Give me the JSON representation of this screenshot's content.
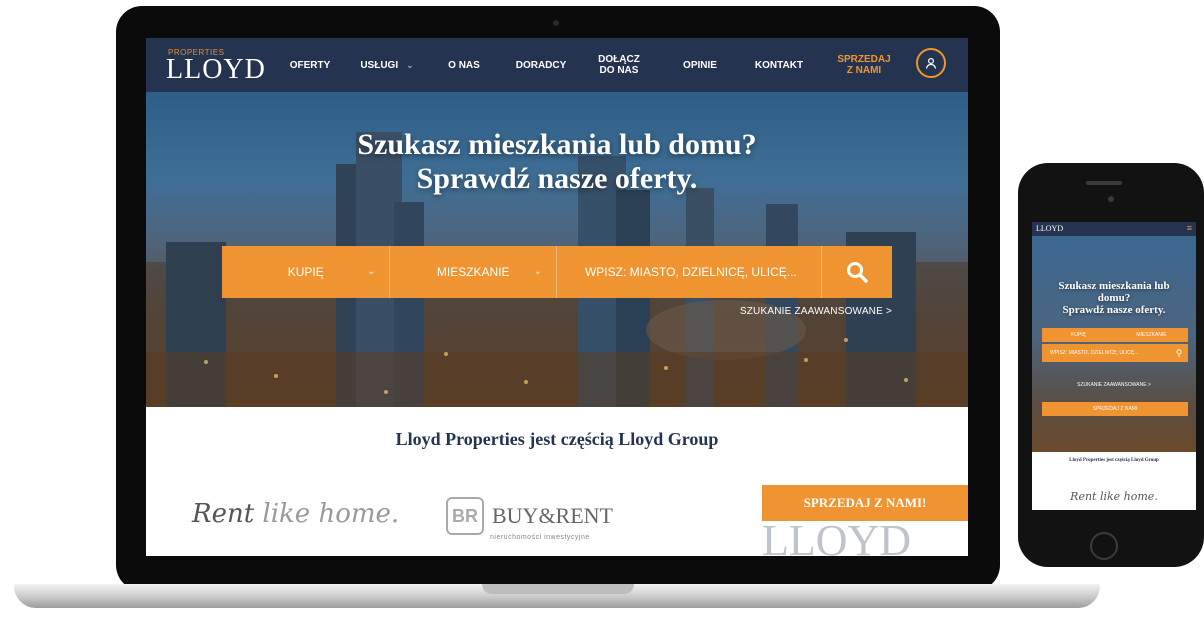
{
  "laptop": {
    "nav": {
      "logo_small": "PROPERTIES",
      "logo": "LLOYD",
      "items": [
        {
          "label": "OFERTY"
        },
        {
          "label": "USŁUGI",
          "chevron": "chevron-down-icon"
        },
        {
          "label": "O NAS"
        },
        {
          "label": "DORADCY"
        },
        {
          "label": "DOŁĄCZ DO NAS"
        },
        {
          "label": "OPINIE"
        },
        {
          "label": "KONTAKT"
        },
        {
          "label": "SPRZEDAJ Z NAMI",
          "accent": true
        }
      ],
      "user_icon": "user-icon"
    },
    "hero": {
      "title_line1": "Szukasz mieszkania lub domu?",
      "title_line2": "Sprawdź nasze oferty.",
      "search": {
        "type": "KUPIĘ",
        "property": "MIESZKANIE",
        "placeholder": "WPISZ: MIASTO, DZIELNICĘ, ULICĘ..."
      },
      "advanced_link": "SZUKANIE ZAAWANSOWANE >"
    },
    "group": {
      "title": "Lloyd Properties jest częścią Lloyd Group",
      "rent_logo_a": "Rent",
      "rent_logo_b": "like home.",
      "br_mark": "BR",
      "br_logo": "BUY&RENT",
      "br_sub": "nieruchomości inwestycyjne",
      "sell_button": "SPRZEDAJ Z NAMI!",
      "lloyd_logo": "LLOYD"
    }
  },
  "phone": {
    "logo": "LLOYD",
    "title_line1": "Szukasz mieszkania lub",
    "title_line2": "domu?",
    "title_line3": "Sprawdź nasze oferty.",
    "search_type": "KUPIĘ",
    "search_property": "MIESZKANIE",
    "search_placeholder": "WPISZ: MIASTO, DZIELNICĘ, ULICĘ...",
    "advanced_link": "SZUKANIE ZAAWANSOWANE >",
    "sell_button": "SPRZEDAJ Z NAMI",
    "group_title": "Lloyd Properties jest częścią Lloyd Group",
    "rent_logo": "Rent like home."
  },
  "colors": {
    "navy": "#233350",
    "orange": "#ef9430"
  }
}
